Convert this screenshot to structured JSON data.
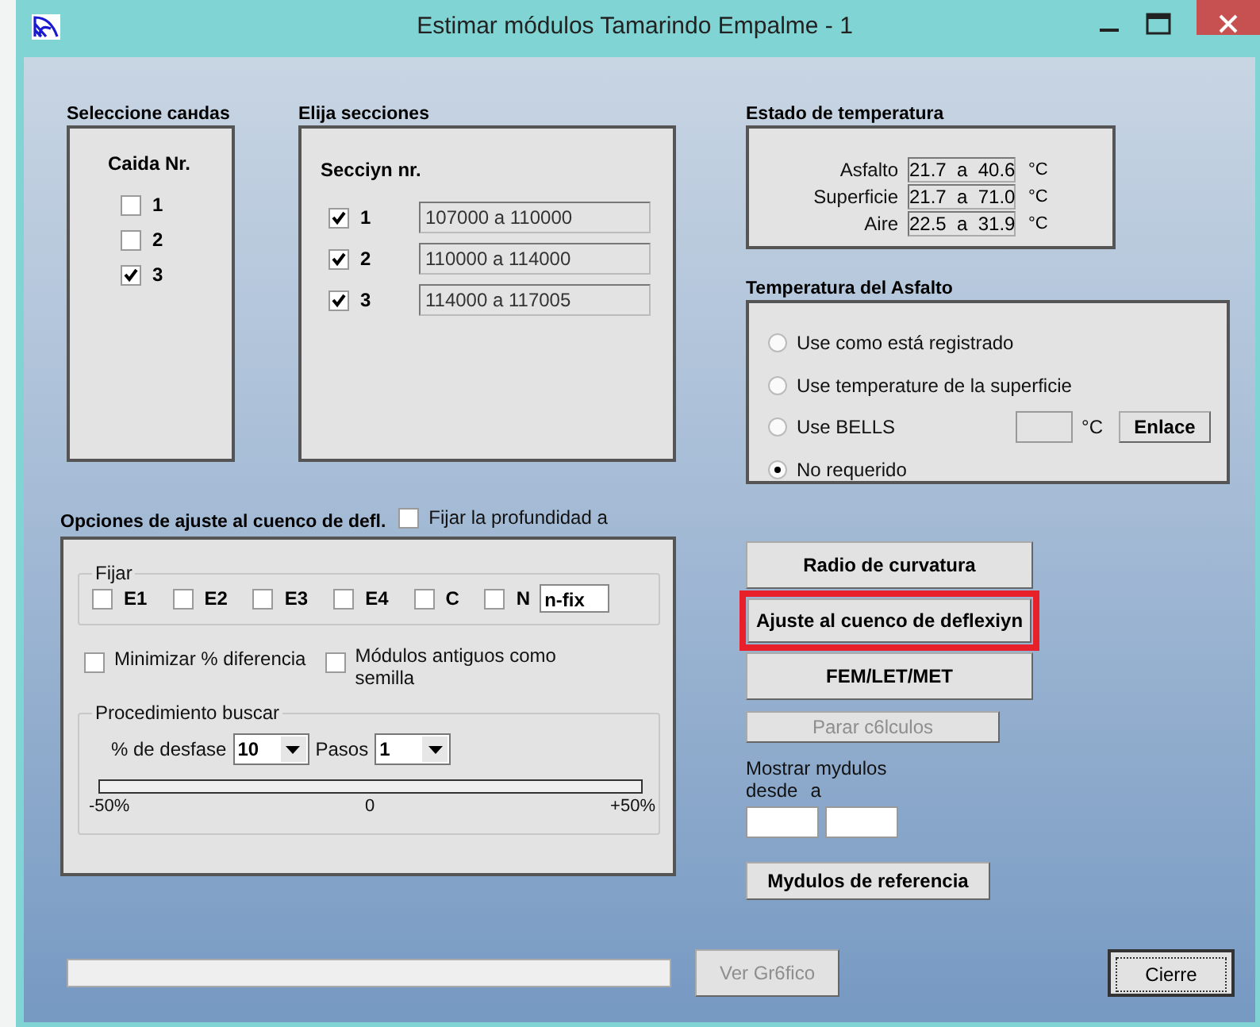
{
  "window": {
    "title": "Estimar módulos Tamarindo Empalme - 1"
  },
  "caidas": {
    "title": "Seleccione caнdas",
    "heading": "Caida Nr.",
    "items": [
      {
        "label": "1",
        "checked": false
      },
      {
        "label": "2",
        "checked": false
      },
      {
        "label": "3",
        "checked": true
      }
    ]
  },
  "secciones": {
    "title": "Elija secciones",
    "heading": "Secciyn nr.",
    "items": [
      {
        "label": "1",
        "checked": true,
        "range": "107000 a 110000"
      },
      {
        "label": "2",
        "checked": true,
        "range": "110000 a 114000"
      },
      {
        "label": "3",
        "checked": true,
        "range": "114000 a 117005"
      }
    ]
  },
  "estado_temperatura": {
    "title": "Estado de temperatura",
    "rows": [
      {
        "label": "Asfalto",
        "value": "21.7  a  40.6",
        "unit": "°C"
      },
      {
        "label": "Superficie",
        "value": "21.7  a  71.0",
        "unit": "°C"
      },
      {
        "label": "Aire",
        "value": "22.5  a  31.9",
        "unit": "°C"
      }
    ]
  },
  "temperatura_asfalto": {
    "title": "Temperatura del Asfalto",
    "options": [
      {
        "label": "Use como está registrado",
        "selected": false
      },
      {
        "label": "Use temperature de la superficie",
        "selected": false
      },
      {
        "label": "Use BELLS",
        "selected": false
      },
      {
        "label": "No requerido",
        "selected": true
      }
    ],
    "bells_unit": "°C",
    "link_button": "Enlace"
  },
  "opciones": {
    "title": "Opciones de ajuste al cuenco de defl.",
    "fijar_profundidad": {
      "label": "Fijar la profundidad a",
      "checked": false
    },
    "fijar": {
      "title": "Fijar",
      "items": [
        {
          "label": "E1",
          "checked": false
        },
        {
          "label": "E2",
          "checked": false
        },
        {
          "label": "E3",
          "checked": false
        },
        {
          "label": "E4",
          "checked": false
        },
        {
          "label": "C",
          "checked": false
        },
        {
          "label": "N",
          "checked": false
        }
      ],
      "nfix_value": "n-fix"
    },
    "minimizar": {
      "label": "Minimizar % diferencia",
      "checked": false
    },
    "modulos_antiguos": {
      "label": "Módulos antiguos como semilla",
      "checked": false
    },
    "procedimiento": {
      "title": "Procedimiento buscar",
      "desfase_label": "% de desfase",
      "desfase_value": "10",
      "pasos_label": "Pasos",
      "pasos_value": "1",
      "scale_labels": [
        "-50%",
        "0",
        "+50%"
      ]
    }
  },
  "actions": [
    {
      "label": "Radio de curvatura",
      "disabled": false,
      "highlighted": false
    },
    {
      "label": "Ajuste al cuenco de deflexiyn",
      "disabled": false,
      "highlighted": true
    },
    {
      "label": "FEM/LET/MET",
      "disabled": false,
      "highlighted": false
    },
    {
      "label": "Parar c6lculos",
      "disabled": true,
      "highlighted": false
    }
  ],
  "mostrar": {
    "label": "Mostrar mydulos",
    "desde": "desde",
    "a": "a"
  },
  "referencia_button": "Mydulos de referencia",
  "ver_grafico": {
    "label": "Ver Gr6fico",
    "disabled": true
  },
  "close_button": "Cierre"
}
